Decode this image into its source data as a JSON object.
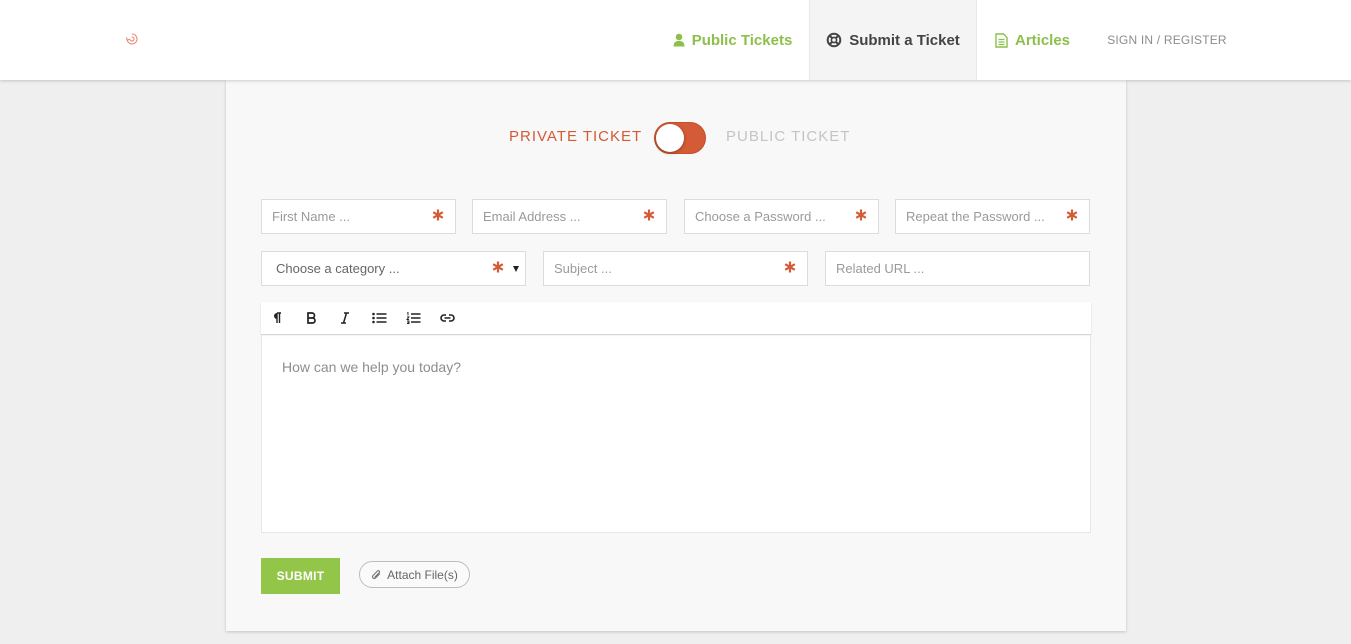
{
  "header": {
    "logo_icon": "spiral-logo-icon",
    "nav": {
      "public_tickets": {
        "label": "Public Tickets",
        "icon": "user-icon"
      },
      "submit_ticket": {
        "label": "Submit a Ticket",
        "icon": "lifebuoy-icon",
        "active": true
      },
      "articles": {
        "label": "Articles",
        "icon": "document-icon"
      }
    },
    "signin": "SIGN IN / REGISTER"
  },
  "form": {
    "toggle": {
      "private_label": "PRIVATE TICKET",
      "public_label": "PUBLIC TICKET",
      "selected": "private"
    },
    "first_name": {
      "placeholder": "First Name ...",
      "required": true
    },
    "email": {
      "placeholder": "Email Address ...",
      "required": true
    },
    "password": {
      "placeholder": "Choose a Password ...",
      "required": true
    },
    "repeat_password": {
      "placeholder": "Repeat the Password ...",
      "required": true
    },
    "category": {
      "value": "Choose a category ...",
      "required": true
    },
    "subject": {
      "placeholder": "Subject ...",
      "required": true
    },
    "related_url": {
      "placeholder": "Related URL ..."
    },
    "editor": {
      "toolbar": [
        "paragraph-icon",
        "bold-icon",
        "italic-icon",
        "bullet-list-icon",
        "numbered-list-icon",
        "link-icon"
      ],
      "placeholder": "How can we help you today?"
    },
    "submit_label": "SUBMIT",
    "attach_label": "Attach File(s)"
  },
  "colors": {
    "accent_green": "#8cc04b",
    "accent_orange": "#d35b35",
    "background": "#efefef"
  }
}
